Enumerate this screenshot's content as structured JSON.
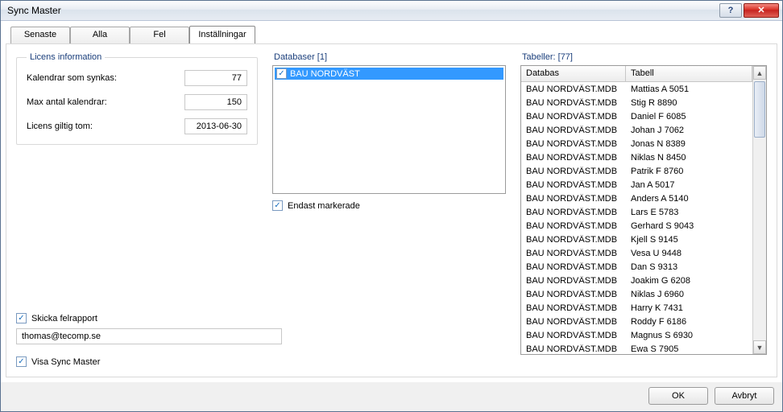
{
  "window": {
    "title": "Sync Master"
  },
  "tabs": {
    "items": [
      {
        "label": "Senaste"
      },
      {
        "label": "Alla"
      },
      {
        "label": "Fel"
      },
      {
        "label": "Inställningar"
      }
    ],
    "active": 3
  },
  "license": {
    "legend": "Licens information",
    "rows": [
      {
        "label": "Kalendrar som synkas:",
        "value": "77"
      },
      {
        "label": "Max antal kalendrar:",
        "value": "150"
      },
      {
        "label": "Licens giltig tom:",
        "value": "2013-06-30"
      }
    ]
  },
  "databases": {
    "label": "Databaser [1]",
    "items": [
      {
        "label": "BAU NORDVÄST",
        "checked": true,
        "selected": true
      }
    ],
    "only_marked_label": "Endast markerade",
    "only_marked_checked": true
  },
  "tables": {
    "label": "Tabeller: [77]",
    "columns": {
      "db": "Databas",
      "tbl": "Tabell"
    },
    "rows": [
      {
        "db": "BAU NORDVÄST.MDB",
        "tbl": "Mattias A 5051"
      },
      {
        "db": "BAU NORDVÄST.MDB",
        "tbl": "Stig R 8890"
      },
      {
        "db": "BAU NORDVÄST.MDB",
        "tbl": "Daniel F 6085"
      },
      {
        "db": "BAU NORDVÄST.MDB",
        "tbl": "Johan J 7062"
      },
      {
        "db": "BAU NORDVÄST.MDB",
        "tbl": "Jonas N 8389"
      },
      {
        "db": "BAU NORDVÄST.MDB",
        "tbl": "Niklas N 8450"
      },
      {
        "db": "BAU NORDVÄST.MDB",
        "tbl": "Patrik F 8760"
      },
      {
        "db": "BAU NORDVÄST.MDB",
        "tbl": "Jan A 5017"
      },
      {
        "db": "BAU NORDVÄST.MDB",
        "tbl": "Anders A 5140"
      },
      {
        "db": "BAU NORDVÄST.MDB",
        "tbl": "Lars E 5783"
      },
      {
        "db": "BAU NORDVÄST.MDB",
        "tbl": "Gerhard S 9043"
      },
      {
        "db": "BAU NORDVÄST.MDB",
        "tbl": "Kjell S 9145"
      },
      {
        "db": "BAU NORDVÄST.MDB",
        "tbl": "Vesa U 9448"
      },
      {
        "db": "BAU NORDVÄST.MDB",
        "tbl": "Dan S 9313"
      },
      {
        "db": "BAU NORDVÄST.MDB",
        "tbl": "Joakim G 6208"
      },
      {
        "db": "BAU NORDVÄST.MDB",
        "tbl": "Niklas J 6960"
      },
      {
        "db": "BAU NORDVÄST.MDB",
        "tbl": "Harry K 7431"
      },
      {
        "db": "BAU NORDVÄST.MDB",
        "tbl": "Roddy F 6186"
      },
      {
        "db": "BAU NORDVÄST.MDB",
        "tbl": "Magnus S 6930"
      },
      {
        "db": "BAU NORDVÄST.MDB",
        "tbl": "Ewa S 7905"
      }
    ]
  },
  "error_report": {
    "label": "Skicka felrapport",
    "checked": true,
    "email": "thomas@tecomp.se"
  },
  "show_sync_master": {
    "label": "Visa Sync Master",
    "checked": true
  },
  "buttons": {
    "ok": "OK",
    "cancel": "Avbryt"
  }
}
